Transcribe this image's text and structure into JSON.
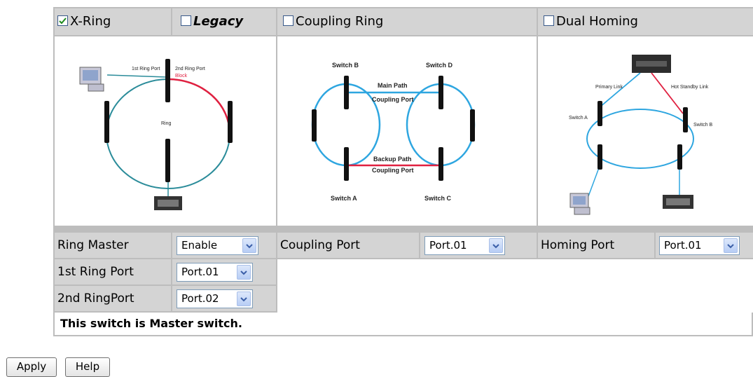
{
  "modes": {
    "xring": {
      "label": "X-Ring",
      "checked": true
    },
    "legacy": {
      "label": "Legacy",
      "checked": false
    },
    "coupling": {
      "label": "Coupling Ring",
      "checked": false
    },
    "dual": {
      "label": "Dual Homing",
      "checked": false
    }
  },
  "diagrams": {
    "xring": {
      "port1": "1st Ring Port",
      "port2": "2nd Ring Port",
      "block": "Block",
      "ring": "Ring"
    },
    "coupling": {
      "switch_b": "Switch B",
      "switch_d": "Switch D",
      "main_path": "Main Path",
      "coupling_port_top": "Coupling Port",
      "backup_path": "Backup Path",
      "coupling_port_bottom": "Coupling Port",
      "switch_a": "Switch A",
      "switch_c": "Switch C"
    },
    "dual": {
      "primary_link": "Primary Link",
      "hot_standby": "Hot Standby Link",
      "switch_a": "Switch A",
      "switch_b": "Switch B"
    }
  },
  "settings": {
    "ring_master": {
      "label": "Ring Master",
      "value": "Enable"
    },
    "first_ring_port": {
      "label": "1st Ring Port",
      "value": "Port.01"
    },
    "second_ring_port": {
      "label": "2nd RingPort",
      "value": "Port.02"
    },
    "coupling_port": {
      "label": "Coupling Port",
      "value": "Port.01"
    },
    "homing_port": {
      "label": "Homing Port",
      "value": "Port.01"
    }
  },
  "status": "This switch is Master switch.",
  "buttons": {
    "apply": "Apply",
    "help": "Help"
  }
}
